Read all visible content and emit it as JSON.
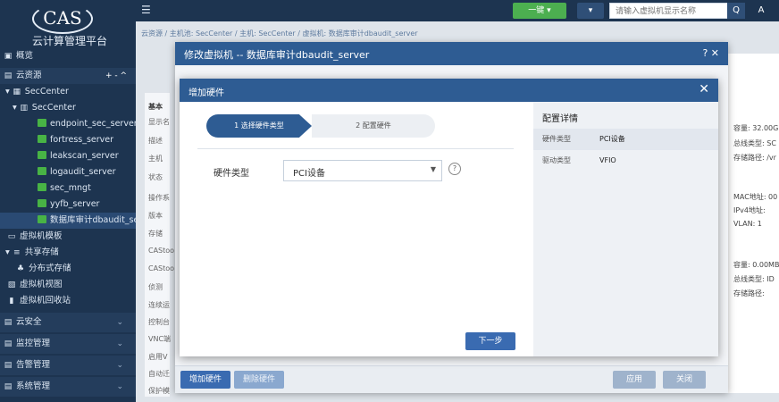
{
  "brand": {
    "logo": "CAS",
    "name": "云计算管理平台"
  },
  "sidebar": {
    "items": [
      {
        "label": "概览",
        "icon": "dashboard-icon"
      },
      {
        "label": "云资源",
        "icon": "cloud-icon",
        "actions": "+ - ^"
      },
      {
        "label": "SecCenter",
        "icon": "datacenter-icon"
      },
      {
        "label": "SecCenter",
        "icon": "host-icon"
      },
      {
        "label": "endpoint_sec_server"
      },
      {
        "label": "fortress_server"
      },
      {
        "label": "leakscan_server"
      },
      {
        "label": "logaudit_server"
      },
      {
        "label": "sec_mngt"
      },
      {
        "label": "yyfb_server"
      },
      {
        "label": "数据库审计dbaudit_server"
      },
      {
        "label": "虚拟机模板"
      },
      {
        "label": "共享存储"
      },
      {
        "label": "分布式存储"
      },
      {
        "label": "虚拟机视图"
      },
      {
        "label": "虚拟机回收站"
      },
      {
        "label": "云安全"
      },
      {
        "label": "监控管理"
      },
      {
        "label": "告警管理"
      },
      {
        "label": "系统管理"
      }
    ]
  },
  "topbar": {
    "menu_icon": "☰",
    "one_key": "一键 ▾",
    "dropdown": "▾",
    "search_placeholder": "请输入虚拟机显示名称",
    "search_icon": "Q",
    "alert_icon": "A"
  },
  "breadcrumb": "云资源 / 主机池: SecCenter / 主机: SecCenter / 虚拟机: 数据库审计dbaudit_server",
  "background": {
    "left_labels": [
      "基本",
      "显示名",
      "描述",
      "主机",
      "状态",
      "操作系",
      "版本",
      "存储",
      "CAStoo",
      "CAStoo",
      "侦测",
      "连续运",
      "控制台",
      "VNC端",
      "启用V",
      "自动迁",
      "保护模"
    ],
    "right_labels": [
      "容量: 32.00G",
      "总线类型: SC",
      "存储路径: /vr",
      "MAC地址: 00",
      "IPv4地址:",
      "VLAN: 1",
      "容量: 0.00MB",
      "总线类型: ID",
      "存储路径:"
    ]
  },
  "outer_dialog": {
    "title": "修改虚拟机 -- 数据库审计dbaudit_server",
    "controls": "? ✕",
    "add_hw": "增加硬件",
    "del_hw": "删除硬件",
    "apply": "应用",
    "close": "关闭"
  },
  "inner_dialog": {
    "title": "增加硬件",
    "close": "✕",
    "step1": "1 选择硬件类型",
    "step2": "2 配置硬件",
    "field_label": "硬件类型",
    "field_value": "PCI设备",
    "next": "下一步",
    "detail_title": "配置详情",
    "details": [
      {
        "key": "硬件类型",
        "value": "PCI设备"
      },
      {
        "key": "驱动类型",
        "value": "VFIO"
      }
    ]
  }
}
